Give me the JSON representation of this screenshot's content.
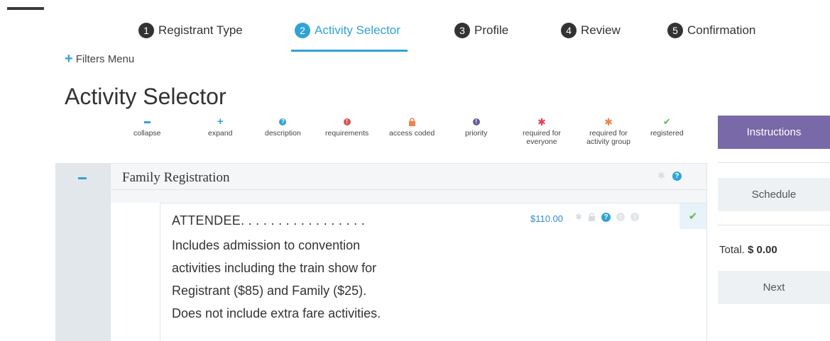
{
  "steps": [
    {
      "number": "1",
      "label": "Registrant Type"
    },
    {
      "number": "2",
      "label": "Activity Selector"
    },
    {
      "number": "3",
      "label": "Profile"
    },
    {
      "number": "4",
      "label": "Review"
    },
    {
      "number": "5",
      "label": "Confirmation"
    }
  ],
  "active_step": "2",
  "filters_menu": "Filters Menu",
  "page_title": "Activity Selector",
  "legend": [
    {
      "label": "collapse",
      "icon": "minus-icon",
      "color": "#2fa3d6"
    },
    {
      "label": "expand",
      "icon": "plus-icon",
      "color": "#2fa3d6"
    },
    {
      "label": "description",
      "icon": "question-icon",
      "color": "#2fa3d6"
    },
    {
      "label": "requirements",
      "icon": "exclamation-icon",
      "color": "#d9534f"
    },
    {
      "label": "access coded",
      "icon": "lock-icon",
      "color": "#f0824a"
    },
    {
      "label": "priority",
      "icon": "priority-icon",
      "color": "#6a5a9a"
    },
    {
      "label": "required for everyone",
      "icon": "asterisk-icon",
      "color": "#e0405a"
    },
    {
      "label": "required for activity group",
      "icon": "asterisk-icon",
      "color": "#f0824a"
    },
    {
      "label": "registered",
      "icon": "check-icon",
      "color": "#5cb85c"
    }
  ],
  "group": {
    "title": "Family Registration"
  },
  "activity": {
    "name": "ATTENDEE. . . . . . . . . . . . . . . . .",
    "price": "$110.00",
    "description_lines": [
      "Includes admission to convention",
      "activities including the train show for",
      "Registrant ($85) and Family ($25).",
      "Does not include extra fare activities."
    ]
  },
  "sidebar": {
    "instructions": "Instructions",
    "schedule": "Schedule",
    "total_label": "Total.",
    "total_value": "$ 0.00",
    "next": "Next"
  },
  "colors": {
    "accent": "#2fa3d6",
    "instructions_bg": "#7a69a8",
    "check": "#5cb85c"
  }
}
